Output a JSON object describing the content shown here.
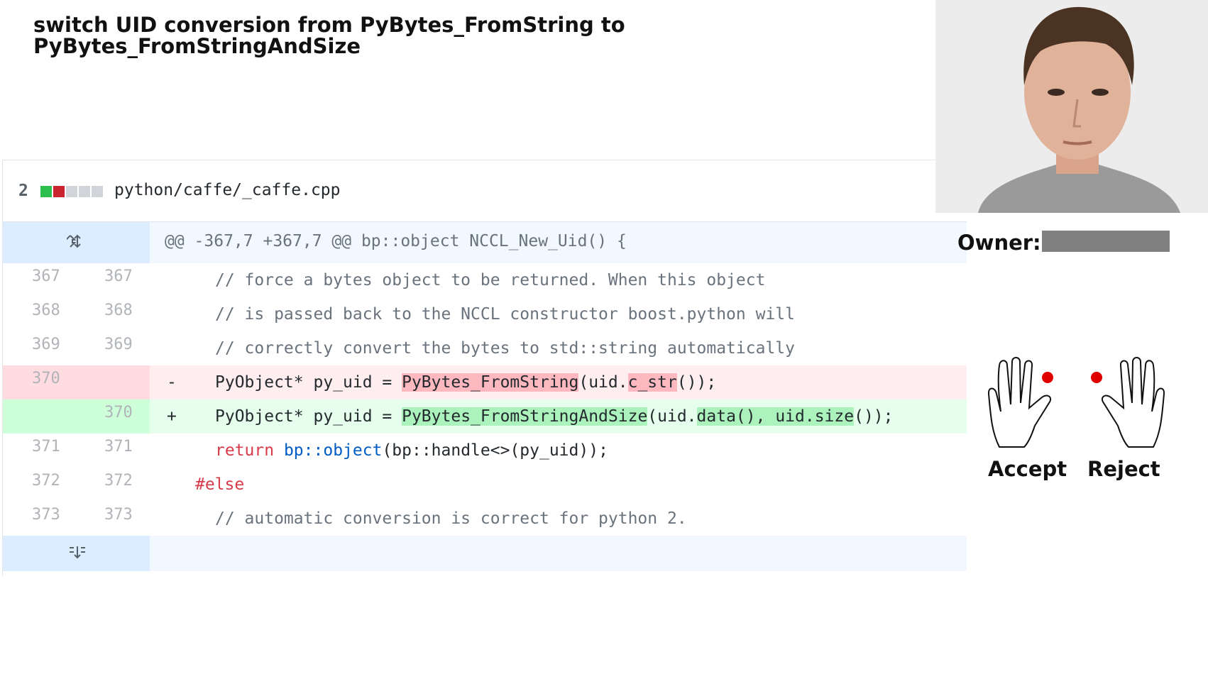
{
  "title": {
    "line1": "switch UID conversion from PyBytes_FromString to",
    "line2": "PyBytes_FromStringAndSize"
  },
  "file": {
    "changes": "2",
    "path": "python/caffe/_caffe.cpp"
  },
  "hunk_header": "@@ -367,7 +367,7 @@ bp::object NCCL_New_Uid() {",
  "lines": [
    {
      "old": "367",
      "new": "367",
      "text": "// force a bytes object to be returned. When this object"
    },
    {
      "old": "368",
      "new": "368",
      "text": "// is passed back to the NCCL constructor boost.python will"
    },
    {
      "old": "369",
      "new": "369",
      "text": "// correctly convert the bytes to std::string automatically"
    },
    {
      "old": "370",
      "sign": "-",
      "text_a": "PyObject* py_uid = ",
      "text_b": "PyBytes_FromString",
      "text_c": "(uid.",
      "text_d": "c_str",
      "text_e": "());"
    },
    {
      "new": "370",
      "sign": "+",
      "text_a": "PyObject* py_uid = ",
      "text_b": "PyBytes_FromStringAndSize",
      "text_c": "(uid.",
      "text_d": "data(), uid.size",
      "text_e": "());"
    },
    {
      "old": "371",
      "new": "371",
      "kw": "return",
      "fn": "bp::object",
      "rest": "(bp::handle<>(py_uid));"
    },
    {
      "old": "372",
      "new": "372",
      "text": "#else"
    },
    {
      "old": "373",
      "new": "373",
      "text": "// automatic conversion is correct for python 2."
    }
  ],
  "owner": {
    "label": "Owner:"
  },
  "actions": {
    "accept": "Accept",
    "reject": "Reject"
  },
  "colors": {
    "marker": "#e00000",
    "deletion_bg": "#ffeef0",
    "addition_bg": "#e6ffed",
    "hunk_bg": "#f1f8ff"
  }
}
